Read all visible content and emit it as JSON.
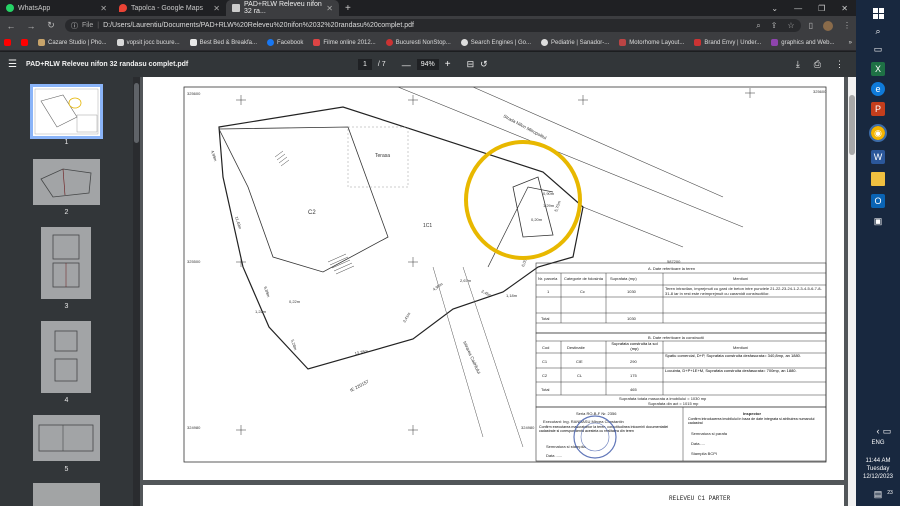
{
  "tabs": [
    {
      "title": "WhatsApp",
      "active": false
    },
    {
      "title": "Tapolca - Google Maps",
      "active": false
    },
    {
      "title": "PAD+RLW Releveu nifon 32 ra...",
      "active": true
    }
  ],
  "address": {
    "scheme": "File",
    "url": "D:/Users/Laurentiu/Documents/PAD+RLW%20Releveu%20nifon%2032%20randasu%20complet.pdf"
  },
  "bookmarks": [
    {
      "label": "Cazare Studio | Pho...",
      "color": "#c7a36a"
    },
    {
      "label": "vopsit jocc bucure...",
      "color": "#d9d9d9"
    },
    {
      "label": "Best Bed & Breakfa...",
      "color": "#e8e8e8"
    },
    {
      "label": "Facebook",
      "color": "#1877f2"
    },
    {
      "label": "Filme online 2012...",
      "color": "#d44"
    },
    {
      "label": "Bucuresti NonStop...",
      "color": "#c33"
    },
    {
      "label": "Search Engines | Go...",
      "color": "#ddd"
    },
    {
      "label": "Pediatrie | Sanador-...",
      "color": "#ddd"
    },
    {
      "label": "Motorhome Layout...",
      "color": "#b44"
    },
    {
      "label": "Brand Envy | Under...",
      "color": "#c33"
    },
    {
      "label": "graphics and Web...",
      "color": "#8e44ad"
    }
  ],
  "pdf": {
    "title": "PAD+RLW Releveu nifon 32 randasu complet.pdf",
    "current_page": "1",
    "total_pages": "/ 7",
    "zoom": "94%"
  },
  "thumbnails": [
    "1",
    "2",
    "3",
    "4",
    "5"
  ],
  "drawing": {
    "street": "Strada Nifon Mitropolitul",
    "terrace": "Terasa",
    "c2": "C2",
    "c1": "1C1",
    "alley": "Intrarea Cadrilului",
    "code": "IE 220157",
    "grid": [
      "325600",
      "325500",
      "325600",
      "324980",
      "324980",
      "587100",
      "587200",
      "587200",
      "587148"
    ],
    "dims": [
      "0,90m",
      "1,29m",
      "0,20m",
      "5,70m",
      "2,67m",
      "2,45m",
      "1,18m",
      "13,78m",
      "0,22m",
      "1,22m",
      "4,99m",
      "11,49m",
      "6,89m",
      "5,28m",
      "4,95m",
      "6,00m",
      "3,41m"
    ],
    "points": [
      "36",
      "37",
      "38",
      "39",
      "35",
      "30",
      "31",
      "32",
      "33",
      "34",
      "25",
      "26",
      "27",
      "28",
      "29",
      "20",
      "21",
      "22",
      "23",
      "24",
      "12",
      "13",
      "14",
      "15",
      "16",
      "17",
      "18",
      "19",
      "1",
      "2",
      "3",
      "4",
      "5",
      "6",
      "7",
      "8",
      "9",
      "10",
      "11",
      "40"
    ]
  },
  "tableA": {
    "title": "A. Date referitoare la teren",
    "headers": [
      "Nr. parcela",
      "Categorie de folosinta",
      "Suprafata (mp)",
      "Mentiuni"
    ],
    "row": [
      "1",
      "Cc",
      "1030"
    ],
    "note": "Teren intravilan, imprejmuit cu gard de beton intre punctele 21-22-23-24-1-2-3-4-5-6-7-8-31-8 iar in rest este neimprejmuit cu caramidt constructiilor.",
    "total_label": "Total",
    "total": "1030"
  },
  "tableB": {
    "title": "B. Date referitoare la constructii",
    "headers": [
      "Cod",
      "Destinatie",
      "Suprafata construita la sol (mp)",
      "Mentiuni"
    ],
    "rows": [
      {
        "code": "C1",
        "dest": "CIE",
        "area": "290",
        "note": "Spatiu comercial, D+P, Suprafata construita desfasurata= 340,8mp, an 1880."
      },
      {
        "code": "C2",
        "dest": "CL",
        "area": "175",
        "note": "Locuinta, D+P+1E+M, Suprafata construita desfasurata= 700mp, an 1880."
      }
    ],
    "total_label": "Total",
    "total": "465"
  },
  "summary": {
    "line1": "Suprafata totala masurata a imobilului = 1030 mp",
    "line2": "Suprafata din act = 1015 mp"
  },
  "executant": {
    "cert": "Seria RO-B-F Nr. 2356",
    "name": "Executant: Ing. RANDASU Mircea Constantin",
    "confirm": "Confirm executarea masuratorilor la teren, corectitudinea intocmirii documentatiei cadastrale si corespondenta acesteia cu realitatea din teren",
    "sign": "Semnatura si stampila",
    "date": "Data ......"
  },
  "inspector": {
    "title": "Inspector",
    "confirm": "Confirm introducerea imobilului in baza de date integrata si atribuirea numarului cadastral",
    "sign": "Semnatura si parafa",
    "date": "Data.....",
    "stamp": "Stampila BCPI"
  },
  "page2_header": "RELEVEU   C1 PARTER",
  "system": {
    "time": "11:44 AM",
    "day": "Tuesday",
    "date": "12/12/2023",
    "lang": "ENG",
    "notif": "23"
  }
}
